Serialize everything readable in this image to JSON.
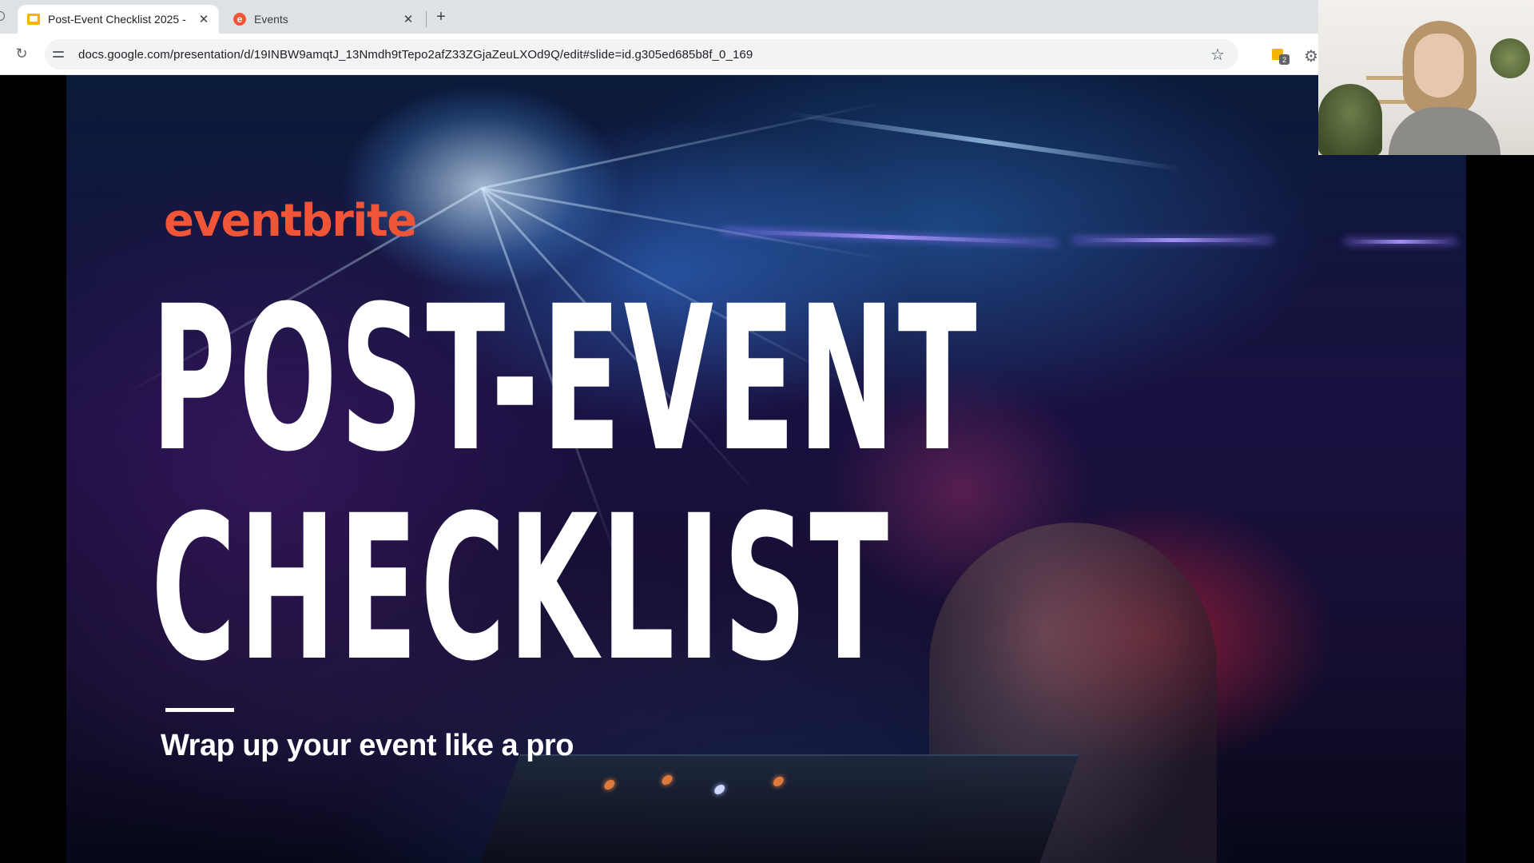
{
  "browser": {
    "tabs": [
      {
        "title": "Post-Event Checklist 2025 - ",
        "icon": "google-slides-icon",
        "active": true
      },
      {
        "title": "Events",
        "icon": "eventbrite-icon",
        "active": false
      }
    ],
    "url": "docs.google.com/presentation/d/19INBW9amqtJ_13Nmdh9tTepo2afZ33ZGjaZeuLXOd9Q/edit#slide=id.g305ed685b8f_0_169",
    "extension_badge": "2",
    "glyphs": {
      "close": "✕",
      "new_tab": "+",
      "reload": "↻",
      "star": "☆",
      "settings": "⚙"
    }
  },
  "slide": {
    "logo": "eventbrite",
    "title_line1": "POST-EVENT",
    "title_line2": "CHECKLIST",
    "subtitle": "Wrap up your event like a pro"
  },
  "colors": {
    "brand_orange": "#f05537",
    "title_white": "#ffffff",
    "tabbar": "#dee1e6"
  }
}
